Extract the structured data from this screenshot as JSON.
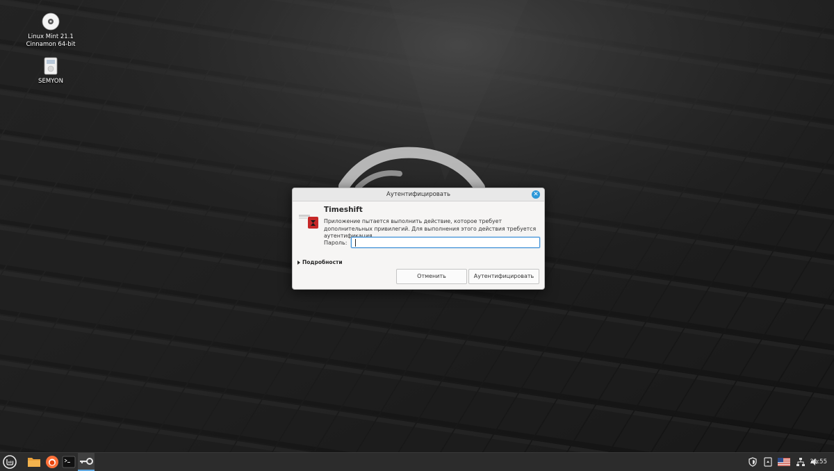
{
  "desktop": {
    "icons": [
      {
        "label_line1": "Linux Mint 21.1",
        "label_line2": "Cinnamon 64-bit",
        "icon": "disc-icon"
      },
      {
        "label_line1": "SEMYON",
        "label_line2": "",
        "icon": "drive-icon"
      }
    ]
  },
  "dialog": {
    "title": "Аутентифицировать",
    "app_name": "Timeshift",
    "message": "Приложение пытается выполнить действие, которое требует дополнительных привилегий. Для выполнения этого действия требуется аутентификация.",
    "password_label": "Пароль:",
    "password_value": "",
    "details_label": "Подробности",
    "cancel_label": "Отменить",
    "authenticate_label": "Аутентифицировать",
    "accent_color": "#2d98d8"
  },
  "taskbar": {
    "launchers": [
      "mint-menu-icon",
      "files-folder-icon",
      "firefox-icon",
      "terminal-icon",
      "key-authentication-icon"
    ],
    "tray": [
      "shield-icon",
      "update-manager-icon",
      "us-flag-icon",
      "network-icon",
      "volume-icon"
    ],
    "clock": "21:55"
  }
}
